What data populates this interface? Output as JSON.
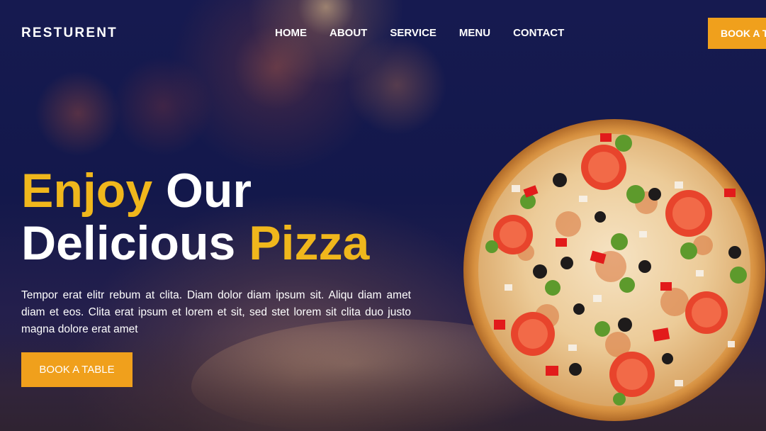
{
  "brand": {
    "name": "RESTURENT"
  },
  "nav": {
    "links": [
      "HOME",
      "ABOUT",
      "SERVICE",
      "MENU",
      "CONTACT"
    ],
    "cta_label": "BOOK A TABLE"
  },
  "hero": {
    "headline": {
      "line1_highlight": "Enjoy",
      "line1_rest": " Our",
      "line2_start": "Delicious ",
      "line2_highlight": "Pizza"
    },
    "description": "Tempor erat elitr rebum at clita. Diam dolor diam ipsum sit. Aliqu diam amet diam et eos. Clita erat ipsum et lorem et sit, sed stet lorem sit clita duo justo magna dolore erat amet",
    "cta_label": "BOOK A TABLE"
  },
  "colors": {
    "accent": "#f0a01c",
    "highlight_text": "#f0b71c",
    "background": "#13184b",
    "text": "#ffffff"
  },
  "icons": {
    "pizza_image": "pizza-image"
  }
}
